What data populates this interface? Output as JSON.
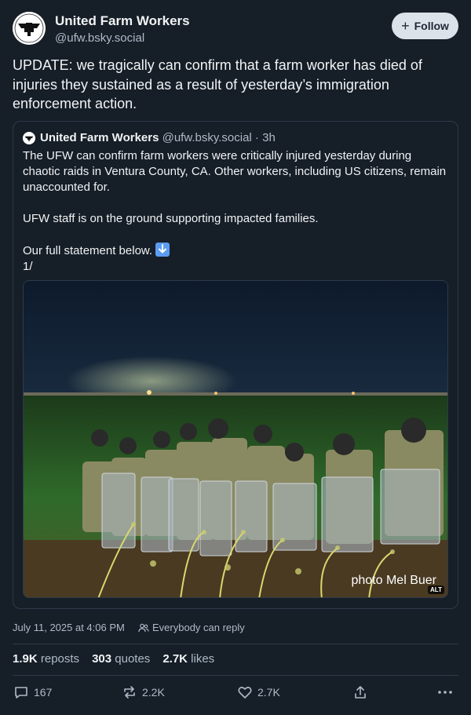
{
  "author": {
    "display_name": "United Farm Workers",
    "handle": "@ufw.bsky.social",
    "avatar_icon": "ufw-eagle-logo"
  },
  "follow_button": {
    "label": "Follow",
    "icon": "plus-icon"
  },
  "post": {
    "text": "UPDATE: we tragically can confirm that a farm worker has died of injuries they sustained as a result of yesterday’s immigration enforcement action."
  },
  "quote": {
    "author_name": "United Farm Workers",
    "author_handle": "@ufw.bsky.social",
    "separator": " · ",
    "age": "3h",
    "paragraphs": [
      "The UFW can confirm farm workers were critically injured yesterday during chaotic raids in Ventura County, CA. Other workers, including US citizens, remain unaccounted for.",
      "UFW staff is on the ground supporting impacted families.",
      "Our full statement below.",
      "1/"
    ],
    "image": {
      "credit": "photo Mel Buer",
      "alt_badge": "ALT"
    }
  },
  "meta": {
    "timestamp": "July 11, 2025 at 4:06 PM",
    "reply_setting": "Everybody can reply"
  },
  "stats": {
    "reposts_count": "1.9K",
    "reposts_label": "reposts",
    "quotes_count": "303",
    "quotes_label": "quotes",
    "likes_count": "2.7K",
    "likes_label": "likes"
  },
  "actions": {
    "reply_count": "167",
    "repost_count": "2.2K",
    "like_count": "2.7K"
  },
  "colors": {
    "background": "#161e27",
    "text": "#f1f3f5",
    "muted": "#aebbc9",
    "border": "#2e3b4a",
    "follow_bg": "#dce2ea"
  }
}
